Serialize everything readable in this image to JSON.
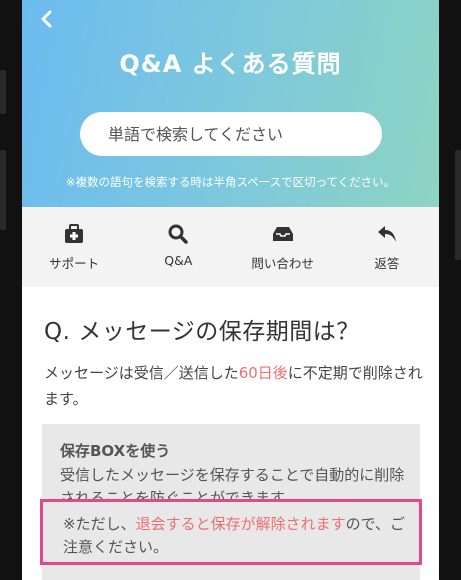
{
  "header": {
    "back_icon": "chevron-left-icon",
    "title": "Q&A よくある質問",
    "search_placeholder": "単語で検索してください",
    "hint": "※複数の語句を検索する時は半角スペースで区切ってください。",
    "gradient_start": "#6cbbef",
    "gradient_end": "#8dd4c4"
  },
  "tabs": [
    {
      "label": "サポート",
      "icon": "first-aid-icon"
    },
    {
      "label": "Q&A",
      "icon": "search-icon"
    },
    {
      "label": "問い合わせ",
      "icon": "inbox-icon"
    },
    {
      "label": "返答",
      "icon": "reply-icon"
    }
  ],
  "question": {
    "title": "Q. メッセージの保存期間は？",
    "answer_pre": "メッセージは受信／送信した",
    "answer_highlight": "60日後",
    "answer_post": "に不定期で削除されます。"
  },
  "note": {
    "title": "保存BOXを使う",
    "text": "受信したメッセージを保存することで自動的に削除されることを防ぐことができます。"
  },
  "warning": {
    "pre": "※ただし、",
    "highlight": "退会すると保存が解除されます",
    "post": "ので、ご注意ください。"
  },
  "colors": {
    "highlight": "#ee6f6f",
    "warning_border": "#e5488a"
  }
}
